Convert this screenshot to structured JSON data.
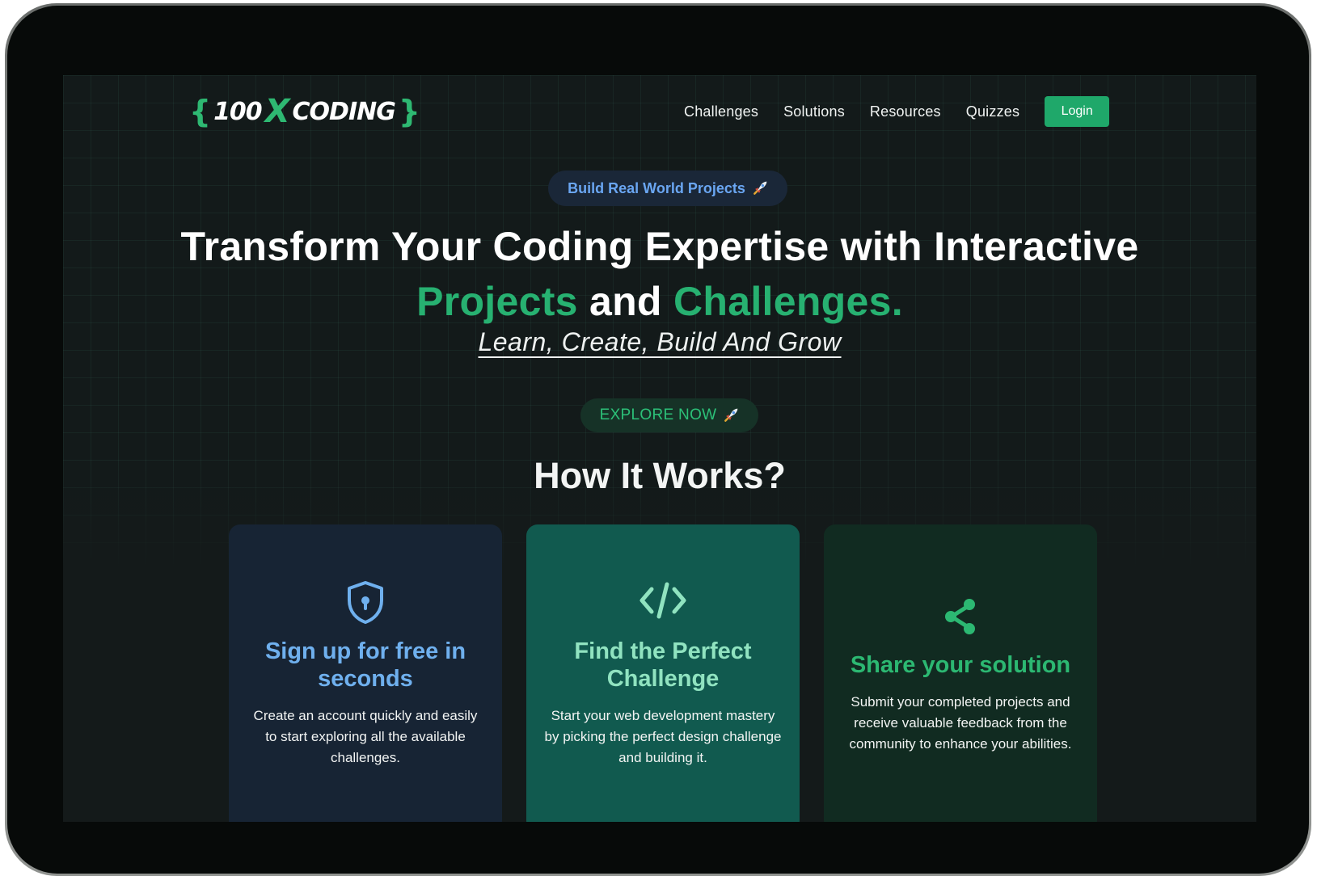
{
  "brand": {
    "open_brace": "{",
    "num": "100",
    "x": "X",
    "word": "CODING",
    "close_brace": "}"
  },
  "nav": {
    "items": [
      "Challenges",
      "Solutions",
      "Resources",
      "Quizzes"
    ],
    "login_label": "Login"
  },
  "hero": {
    "pill_label": "Build Real World Projects",
    "headline_line1": "Transform Your Coding Expertise with Interactive",
    "headline_projects": "Projects",
    "headline_and": " and ",
    "headline_challenges": "Challenges.",
    "subline": "Learn, Create, Build And Grow",
    "cta_label": "EXPLORE NOW"
  },
  "how": {
    "title": "How It Works?",
    "cards": [
      {
        "icon": "shield-lock-icon",
        "title": "Sign up for free in seconds",
        "text": "Create an account quickly and easily to start exploring all the available challenges."
      },
      {
        "icon": "code-icon",
        "title": "Find the Perfect Challenge",
        "text": "Start your web development mastery by picking the perfect design challenge and building it."
      },
      {
        "icon": "share-icon",
        "title": "Share your solution",
        "text": "Submit your completed projects and receive valuable feedback from the community to enhance your abilities."
      }
    ]
  },
  "colors": {
    "accent_green": "#27b171",
    "login_bg": "#1fa86a",
    "pill_text": "#6aa6f2",
    "card1_bg": "#172434",
    "card2_bg": "#115a4f",
    "card3_bg": "#112b21"
  }
}
